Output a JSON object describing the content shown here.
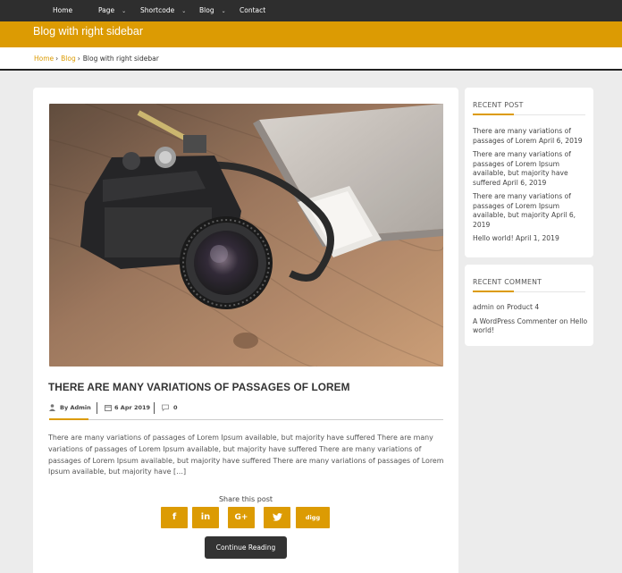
{
  "nav": {
    "items": [
      {
        "label": "Home",
        "dropdown": false
      },
      {
        "label": "Page",
        "dropdown": true
      },
      {
        "label": "Shortcode",
        "dropdown": true
      },
      {
        "label": "Blog",
        "dropdown": true
      },
      {
        "label": "Contact",
        "dropdown": false
      }
    ],
    "chevron": "⌄"
  },
  "page_title": "Blog with right sidebar",
  "breadcrumb": {
    "home": "Home",
    "blog": "Blog",
    "current": "Blog with right sidebar",
    "separator": "›"
  },
  "post": {
    "title": "THERE ARE MANY VARIATIONS OF PASSAGES OF LOREM",
    "author": "By Admin",
    "date": "6 Apr 2019",
    "comments": "0",
    "excerpt": "There are many variations of passages of Lorem Ipsum available, but majority have suffered There are many variations of passages of Lorem Ipsum available, but majority have suffered There are many variations of passages of Lorem Ipsum available, but majority have suffered There are many variations of passages of Lorem Ipsum available, but majority have […]",
    "share_label": "Share this post",
    "share": {
      "facebook": "f",
      "linkedin": "in",
      "googleplus": "G+",
      "twitter": "twitter-icon",
      "digg": "digg"
    },
    "continue_label": "Continue Reading"
  },
  "sidebar": {
    "recent_post_title": "RECENT POST",
    "recent_posts": [
      "There are many variations of passages of Lorem April 6, 2019",
      "There are many variations of passages of Lorem Ipsum available, but majority have suffered April 6, 2019",
      "There are many variations of passages of Lorem Ipsum available, but majority April 6, 2019",
      "Hello world! April 1, 2019"
    ],
    "recent_comment_title": "RECENT COMMENT",
    "recent_comments": [
      {
        "author": "admin",
        "on": "on",
        "post": "Product 4"
      },
      {
        "author": "A WordPress Commenter",
        "on": "on",
        "post": "Hello world!"
      }
    ]
  },
  "colors": {
    "accent": "#dc9b03",
    "nav_bg": "#2e2e2e",
    "button_dark": "#333333"
  }
}
